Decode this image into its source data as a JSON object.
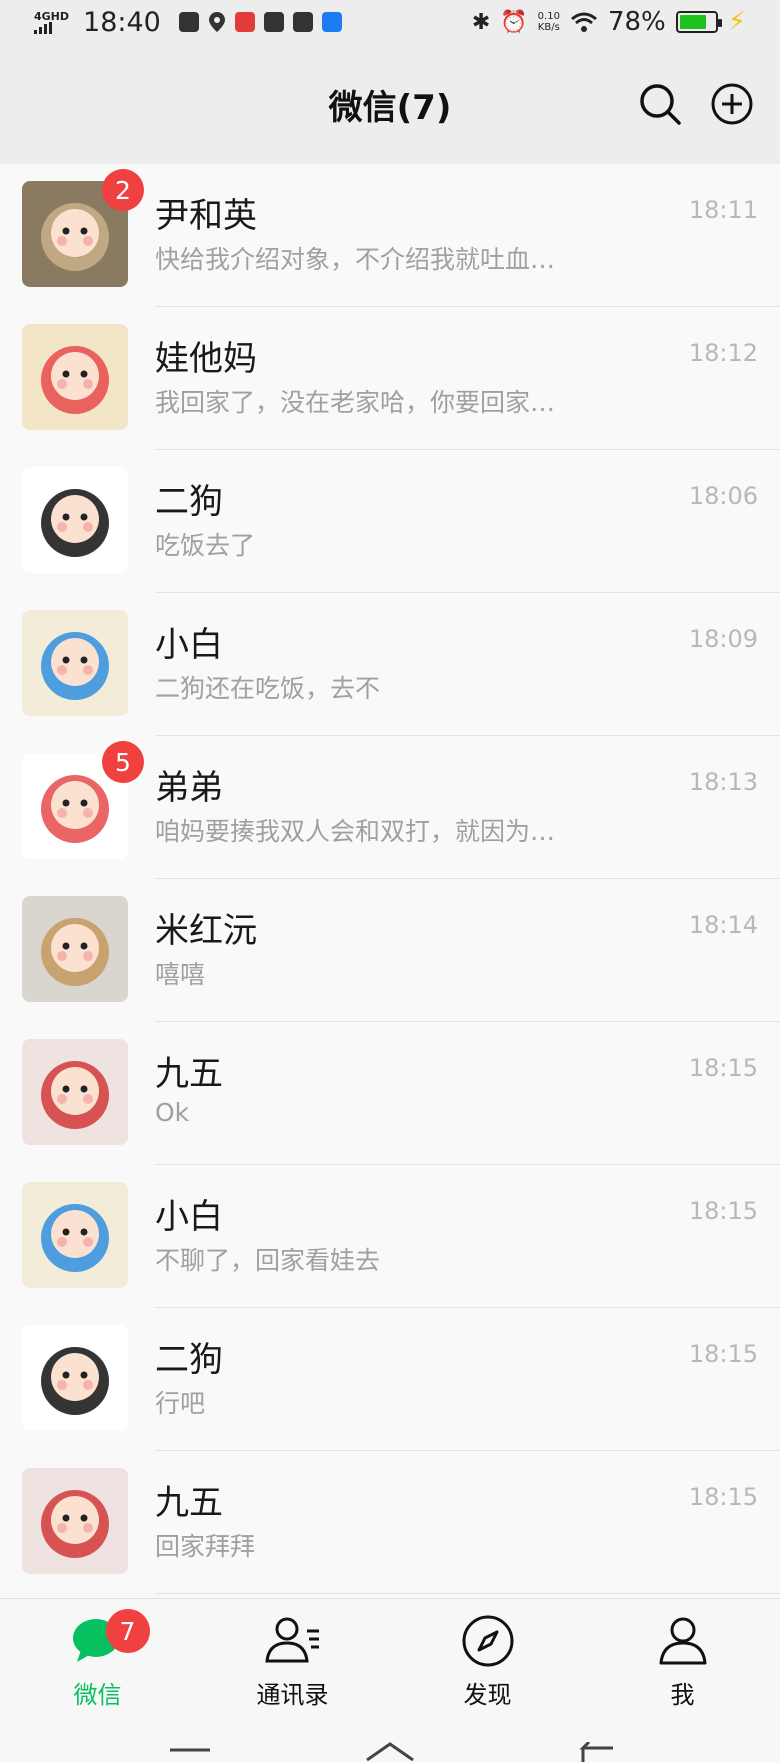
{
  "status_bar": {
    "network": "4GHD",
    "time": "18:40",
    "speed_value": "0.10",
    "speed_unit": "KB/s",
    "battery": "78%",
    "battery_level": 0.78
  },
  "header": {
    "title": "微信(7)"
  },
  "chats": [
    {
      "name": "尹和英",
      "preview": "快给我介绍对象，不介绍我就吐血…",
      "time": "18:11",
      "badge": "2",
      "avatar": "cat-avatar",
      "avatar_colors": [
        "#8a7a62",
        "#c9b08a"
      ]
    },
    {
      "name": "娃他妈",
      "preview": "我回家了，没在老家哈，你要回家…",
      "time": "18:12",
      "badge": "",
      "avatar": "cartoon-girl-avatar",
      "avatar_colors": [
        "#f3e6c8",
        "#e64a4a"
      ]
    },
    {
      "name": "二狗",
      "preview": "吃饭去了",
      "time": "18:06",
      "badge": "",
      "avatar": "cartoon-boy-avatar",
      "avatar_colors": [
        "#ffffff",
        "#111111"
      ]
    },
    {
      "name": "小白",
      "preview": "二狗还在吃饭，去不",
      "time": "18:09",
      "badge": "",
      "avatar": "cartoon-boy-blue-avatar",
      "avatar_colors": [
        "#f3ecd8",
        "#2f8fe0"
      ]
    },
    {
      "name": "弟弟",
      "preview": "咱妈要揍我双人会和双打，就因为…",
      "time": "18:13",
      "badge": "5",
      "avatar": "cartoon-boy-red-avatar",
      "avatar_colors": [
        "#ffffff",
        "#e64a4a"
      ]
    },
    {
      "name": "米红沅",
      "preview": "嘻嘻",
      "time": "18:14",
      "badge": "",
      "avatar": "puppy-photo-avatar",
      "avatar_colors": [
        "#d9d6d0",
        "#c69a5e"
      ]
    },
    {
      "name": "九五",
      "preview": "Ok",
      "time": "18:15",
      "badge": "",
      "avatar": "red-hood-girl-avatar",
      "avatar_colors": [
        "#eee3e0",
        "#d23a3a"
      ]
    },
    {
      "name": "小白",
      "preview": "不聊了，回家看娃去",
      "time": "18:15",
      "badge": "",
      "avatar": "cartoon-boy-blue-avatar",
      "avatar_colors": [
        "#f3ecd8",
        "#2f8fe0"
      ]
    },
    {
      "name": "二狗",
      "preview": "行吧",
      "time": "18:15",
      "badge": "",
      "avatar": "cartoon-boy-avatar",
      "avatar_colors": [
        "#ffffff",
        "#111111"
      ]
    },
    {
      "name": "九五",
      "preview": "回家拜拜",
      "time": "18:15",
      "badge": "",
      "avatar": "red-hood-girl-avatar",
      "avatar_colors": [
        "#eee3e0",
        "#d23a3a"
      ]
    }
  ],
  "tabs": [
    {
      "label": "微信",
      "icon": "chat-bubble-icon",
      "active": true,
      "badge": "7"
    },
    {
      "label": "通讯录",
      "icon": "contacts-icon",
      "active": false,
      "badge": ""
    },
    {
      "label": "发现",
      "icon": "compass-icon",
      "active": false,
      "badge": ""
    },
    {
      "label": "我",
      "icon": "person-icon",
      "active": false,
      "badge": ""
    }
  ],
  "colors": {
    "accent": "#07c160",
    "badge": "#f0403f",
    "header_bg": "#ededed",
    "list_bg": "#f9f9f9"
  }
}
